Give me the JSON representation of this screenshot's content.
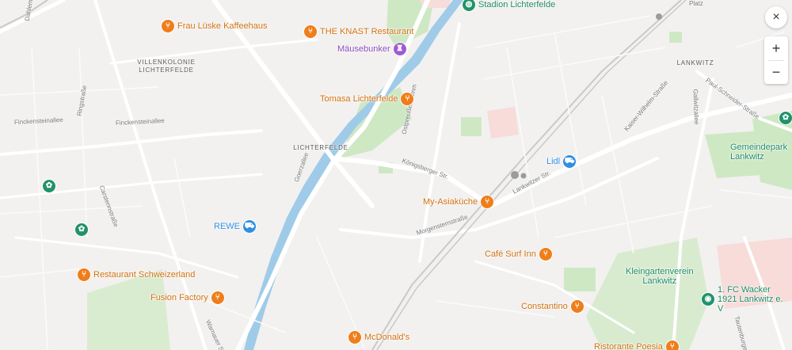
{
  "map": {
    "pois": [
      {
        "id": "frau-luske",
        "label": "Frau Lüske Kaffeehaus",
        "category": "restaurant",
        "icon": "restaurant-icon"
      },
      {
        "id": "knast",
        "label": "THE KNAST Restaurant",
        "category": "restaurant",
        "icon": "restaurant-icon"
      },
      {
        "id": "mausebunker",
        "label": "Mäusebunker",
        "category": "museum",
        "icon": "museum-icon"
      },
      {
        "id": "tomasa",
        "label": "Tomasa Lichterfelde",
        "category": "restaurant",
        "icon": "restaurant-icon"
      },
      {
        "id": "stadion",
        "label": "Stadion Lichterfelde",
        "category": "stadium",
        "icon": "stadium-icon"
      },
      {
        "id": "lidl",
        "label": "Lidl",
        "category": "shop",
        "icon": "shopping-cart-icon"
      },
      {
        "id": "my-asiakuche",
        "label": "My-Asiaküche",
        "category": "restaurant",
        "icon": "restaurant-icon"
      },
      {
        "id": "rewe",
        "label": "REWE",
        "category": "shop",
        "icon": "shopping-cart-icon"
      },
      {
        "id": "cafe-surf",
        "label": "Café Surf Inn",
        "category": "restaurant",
        "icon": "restaurant-icon"
      },
      {
        "id": "schweizerland",
        "label": "Restaurant Schweizerland",
        "category": "restaurant",
        "icon": "restaurant-icon"
      },
      {
        "id": "fusion",
        "label": "Fusion Factory",
        "category": "restaurant",
        "icon": "restaurant-icon"
      },
      {
        "id": "constantino",
        "label": "Constantino",
        "category": "restaurant",
        "icon": "restaurant-icon"
      },
      {
        "id": "mcdonalds",
        "label": "McDonald's",
        "category": "restaurant",
        "icon": "restaurant-icon"
      },
      {
        "id": "ristorante-poesia",
        "label": "Ristorante Poesia",
        "category": "restaurant",
        "icon": "restaurant-icon"
      },
      {
        "id": "kleingartenverein",
        "label": "Kleingartenverein Lankwitz",
        "category": "park",
        "icon": ""
      },
      {
        "id": "gemeindepark",
        "label": "Gemeindepark Lankwitz",
        "category": "park",
        "icon": ""
      },
      {
        "id": "fc-wacker",
        "label": "1. FC Wacker 1921 Lankwitz e. V",
        "category": "sports",
        "icon": "sports-club-icon"
      }
    ],
    "areas": {
      "villenkolonie": "VILLENKOLONIE LICHTERFELDE",
      "lichterfelde": "LICHTERFELDE",
      "lankwitz": "LANKWITZ"
    },
    "streets": {
      "finckensteinallee_w": "Finckensteinallee",
      "finckensteinallee_e": "Finckensteinallee",
      "ringstrasse": "Ringstraße",
      "carstennstrasse": "Carstennstraße",
      "goerzallee": "Goerzallee",
      "warthestrasse": "Warnauer Str.",
      "ostpreussendamm": "Ostpreußendamm",
      "konigsberger": "Königsberger Str.",
      "morgensternstrasse": "Morgensternstraße",
      "lankwitzer": "Lankwitzer Str.",
      "kaiser_wilhelm": "Kaiser-Wilhelm-Straße",
      "paul_schneider": "Paul-Schneider-Straße",
      "gallwitzallee": "Gallwitzallee",
      "tautenburger": "Tautenburger Str.",
      "dahlemer": "Dahlemer",
      "platz": "Platz"
    },
    "controls": {
      "close": "×",
      "zoom_in": "+",
      "zoom_out": "−"
    },
    "colors": {
      "restaurant": "#ef7e1a",
      "shop": "#2f8fe4",
      "museum": "#a05ad4",
      "park": "#21926c",
      "water": "#9fcbe8",
      "green_area": "#cfe8c4",
      "background": "#f2f1ef"
    }
  }
}
